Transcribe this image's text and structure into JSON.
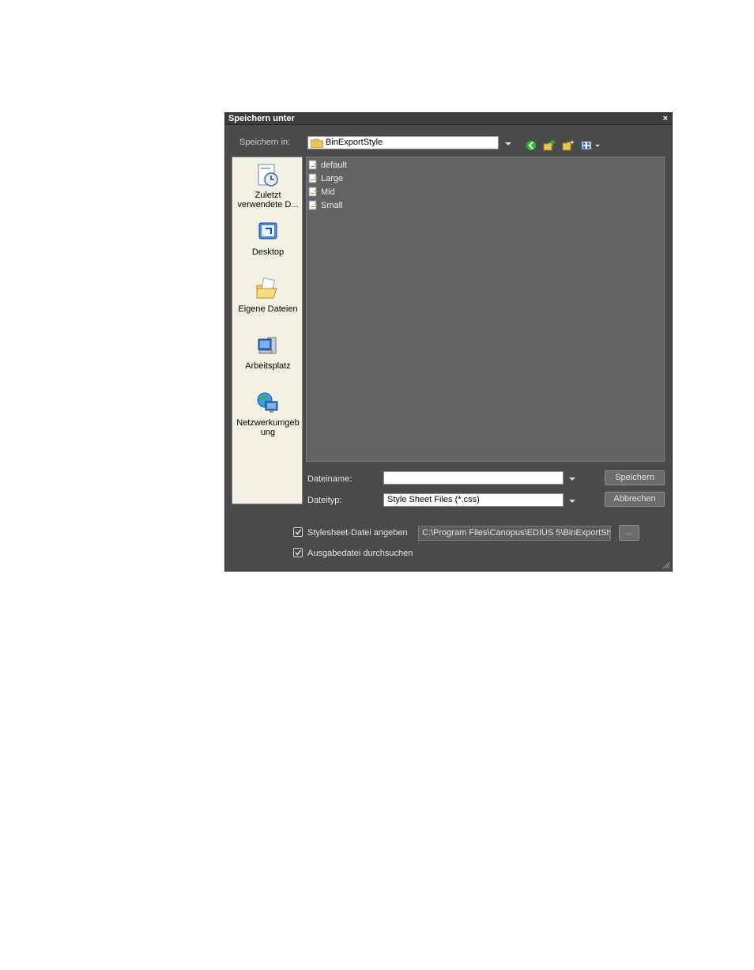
{
  "dialog": {
    "title": "Speichern unter",
    "close": "×"
  },
  "location": {
    "label": "Speichern in:",
    "value": "BinExportStyle"
  },
  "places": [
    {
      "label": "Zuletzt verwendete D...",
      "icon": "recent-documents-icon"
    },
    {
      "label": "Desktop",
      "icon": "desktop-icon"
    },
    {
      "label": "Eigene Dateien",
      "icon": "my-documents-icon"
    },
    {
      "label": "Arbeitsplatz",
      "icon": "my-computer-icon"
    },
    {
      "label": "Netzwerkumgeb ung",
      "icon": "network-icon"
    }
  ],
  "files": [
    "default",
    "Large",
    "Mid",
    "Small"
  ],
  "filename": {
    "label": "Dateiname:",
    "value": ""
  },
  "filetype": {
    "label": "Dateityp:",
    "value": "Style Sheet Files (*.css)"
  },
  "buttons": {
    "save": "Speichern",
    "cancel": "Abbrechen",
    "browse": "..."
  },
  "options": {
    "stylesheet_label": "Stylesheet-Datei angeben",
    "stylesheet_checked": true,
    "stylesheet_path": "C:\\Program Files\\Canopus\\EDIUS 5\\BinExportSty",
    "browse_output_label": "Ausgabedatei durchsuchen",
    "browse_output_checked": true
  },
  "colors": {
    "dialog_bg": "#4a4a4a",
    "list_bg": "#636363",
    "places_bg": "#f3f1e4"
  }
}
